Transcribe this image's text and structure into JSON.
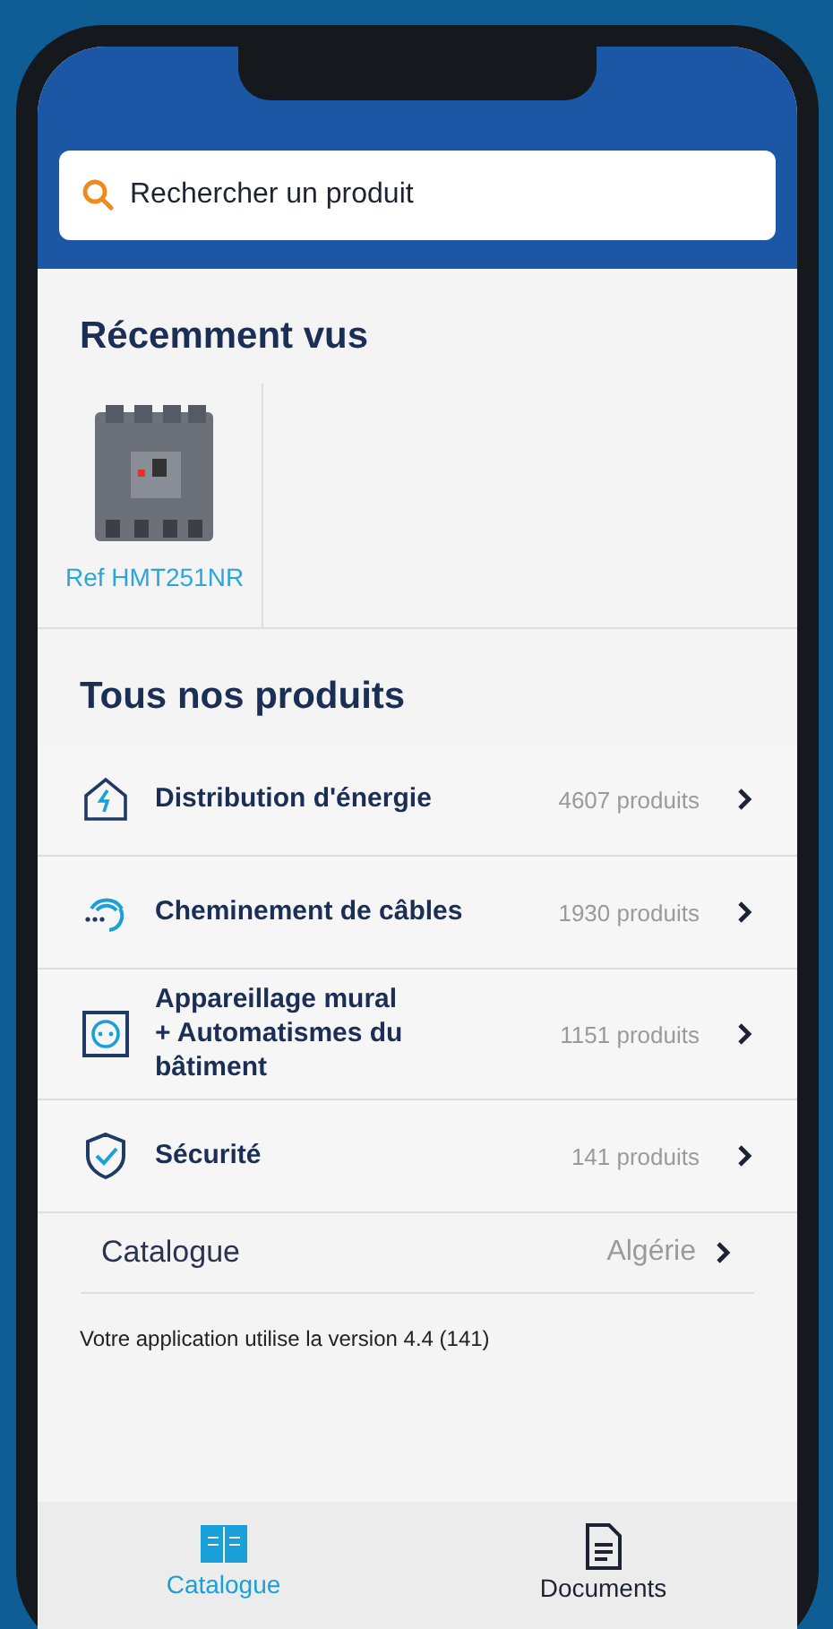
{
  "search": {
    "placeholder": "Rechercher un produit"
  },
  "recently_viewed": {
    "title": "Récemment vus",
    "items": [
      {
        "label": "Ref HMT251NR"
      }
    ]
  },
  "all_products": {
    "title": "Tous nos produits",
    "categories": [
      {
        "kind": "energy",
        "name": "Distribution d'énergie",
        "count": "4607 produits"
      },
      {
        "kind": "cables",
        "name": "Cheminement de câbles",
        "count": "1930 produits"
      },
      {
        "kind": "socket",
        "name": "Appareillage mural\n+ Automatismes du\nbâtiment",
        "count": "1151 produits"
      },
      {
        "kind": "security",
        "name": "Sécurité",
        "count": "141 produits"
      }
    ]
  },
  "catalogue": {
    "label": "Catalogue",
    "value": "Algérie"
  },
  "version_note": "Votre application utilise la version 4.4 (141)",
  "tabs": [
    {
      "label": "Catalogue",
      "kind": "catalogue",
      "selected": true
    },
    {
      "label": "Documents",
      "kind": "documents",
      "selected": false
    }
  ]
}
